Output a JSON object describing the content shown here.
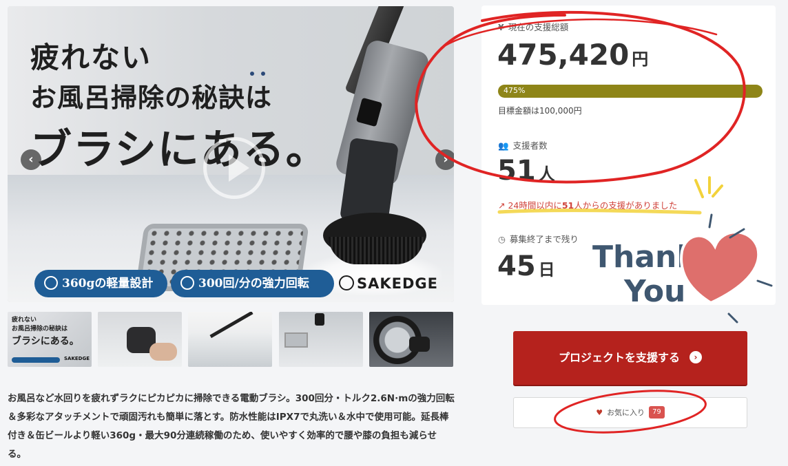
{
  "hero": {
    "headline_line1": "疲れない",
    "headline_line2": "お風呂掃除の秘訣は",
    "headline_line3": "ブラシにある。",
    "feature1": "360gの軽量設計",
    "feature2": "300回/分の強力回転",
    "brand": "SAKEDGE",
    "prev_arrow": "‹",
    "next_arrow": "›"
  },
  "thumbnails": [
    {
      "text_a": "疲れない",
      "text_b": "お風呂掃除の秘訣は",
      "text_c": "ブラシにある。",
      "brand": "SAKEDGE"
    }
  ],
  "description": "お風呂など水回りを疲れずラクにピカピカに掃除できる電動ブラシ。300回分・トルク2.6N·mの強力回転＆多彩なアタッチメントで頑固汚れも簡単に落とす。防水性能はIPX7で丸洗い＆水中で使用可能。延長棒付き＆缶ビールより軽い360g・最大90分連続稼働のため、使いやすく効率的で腰や膝の負担も減らせる。",
  "stats": {
    "funding_label": "現在の支援総額",
    "funding_amount": "475,420",
    "funding_unit": "円",
    "progress_percent": 475,
    "progress_label": "475%",
    "goal_text": "目標金額は100,000円",
    "backers_label": "支援者数",
    "backers_count": "51",
    "backers_unit": "人",
    "trend_prefix": "24時間以内に",
    "trend_count": "51",
    "trend_suffix": "人からの支援がありました",
    "remaining_label": "募集終了まで残り",
    "remaining_days": "45",
    "remaining_unit": "日"
  },
  "actions": {
    "support_button": "プロジェクトを支援する",
    "favorite_label": "お気に入り",
    "favorite_count": "79"
  },
  "overlay": {
    "thank": "Thank",
    "you": "You"
  },
  "colors": {
    "accent_red": "#b5221d",
    "progress_olive": "#8e8518",
    "feature_blue": "#1f5d96",
    "annotation_red": "#e02424"
  }
}
